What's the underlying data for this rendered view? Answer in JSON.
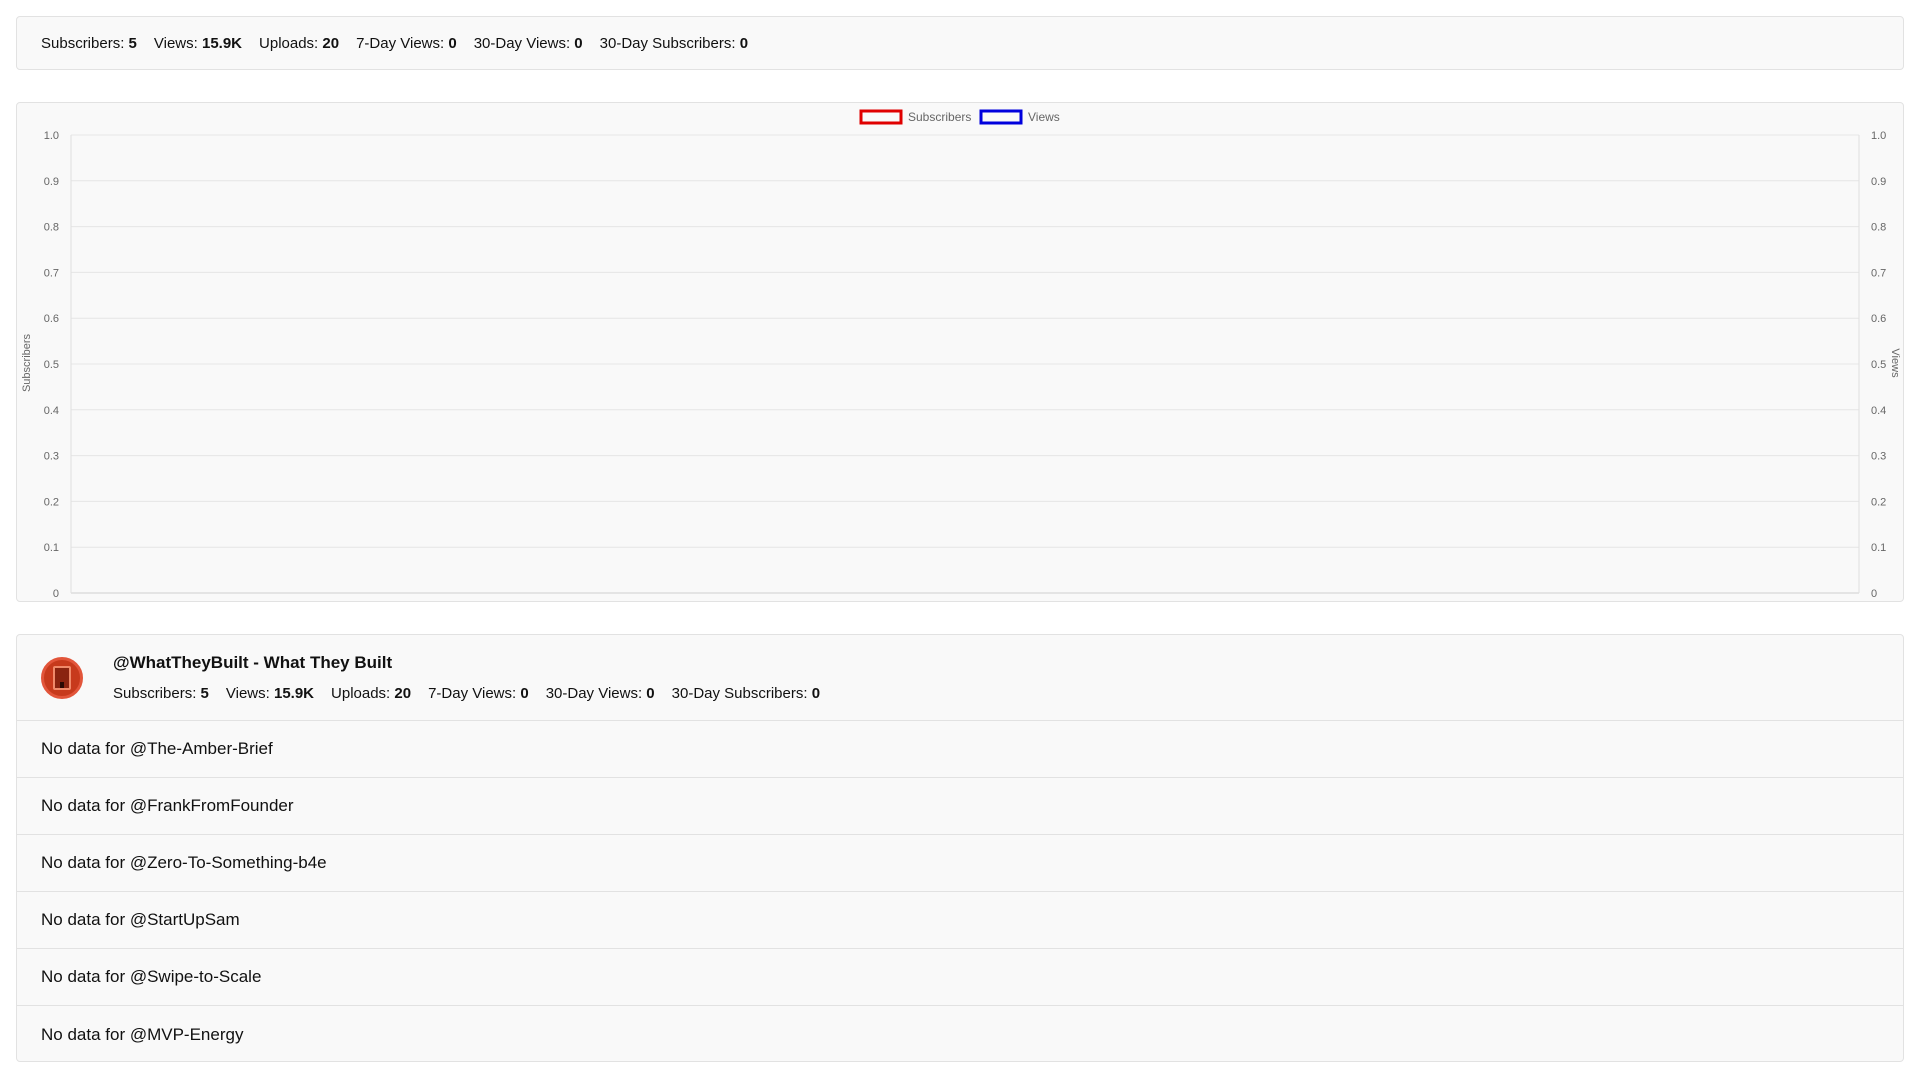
{
  "summary": {
    "stats": [
      {
        "label": "Subscribers:",
        "value": "5"
      },
      {
        "label": "Views:",
        "value": "15.9K"
      },
      {
        "label": "Uploads:",
        "value": "20"
      },
      {
        "label": "7-Day Views:",
        "value": "0"
      },
      {
        "label": "30-Day Views:",
        "value": "0"
      },
      {
        "label": "30-Day Subscribers:",
        "value": "0"
      }
    ]
  },
  "chart_data": {
    "type": "line",
    "series": [
      {
        "name": "Subscribers",
        "color": "#e00000",
        "values": []
      },
      {
        "name": "Views",
        "color": "#0000dd",
        "values": []
      }
    ],
    "ylabel": "Subscribers",
    "y2label": "Views",
    "ylim": [
      0,
      1
    ],
    "y2lim": [
      0,
      1
    ],
    "yticks": [
      "0",
      "0.1",
      "0.2",
      "0.3",
      "0.4",
      "0.5",
      "0.6",
      "0.7",
      "0.8",
      "0.9",
      "1.0"
    ],
    "legend": "top-center",
    "grid": true
  },
  "channel": {
    "title": "@WhatTheyBuilt - What They Built",
    "avatar_icon": "building-icon",
    "stats": [
      {
        "label": "Subscribers:",
        "value": "5"
      },
      {
        "label": "Views:",
        "value": "15.9K"
      },
      {
        "label": "Uploads:",
        "value": "20"
      },
      {
        "label": "7-Day Views:",
        "value": "0"
      },
      {
        "label": "30-Day Views:",
        "value": "0"
      },
      {
        "label": "30-Day Subscribers:",
        "value": "0"
      }
    ]
  },
  "no_data": [
    "No data for @The-Amber-Brief",
    "No data for @FrankFromFounder",
    "No data for @Zero-To-Something-b4e",
    "No data for @StartUpSam",
    "No data for @Swipe-to-Scale",
    "No data for @MVP-Energy"
  ]
}
